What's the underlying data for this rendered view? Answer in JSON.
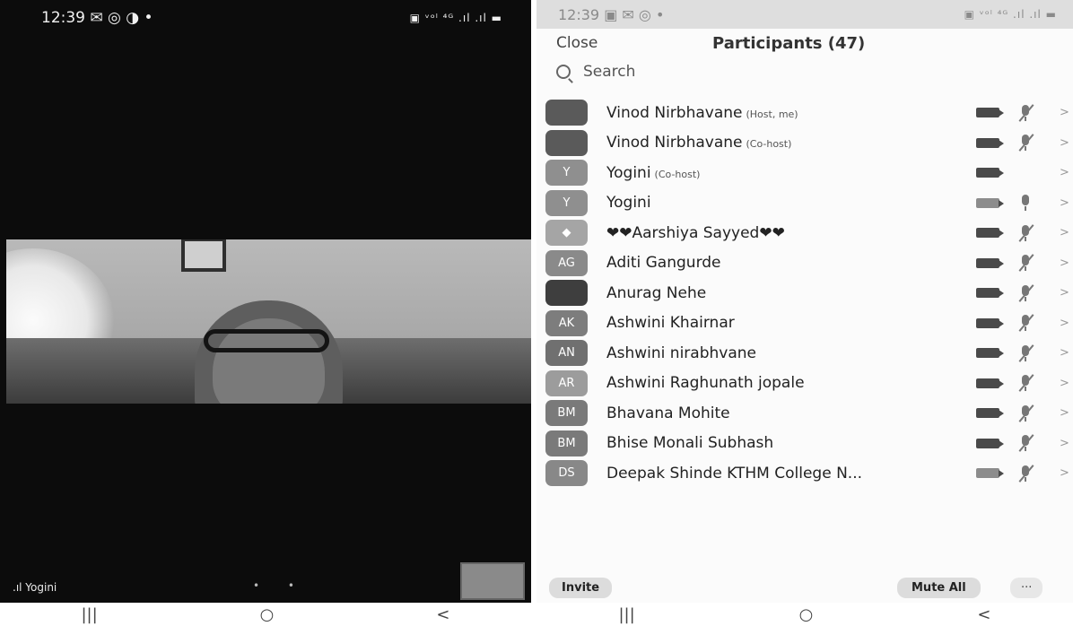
{
  "left_screen": {
    "status_bar": {
      "time": "12:39",
      "icons": "✉ ◎ ◑ •",
      "right": "▣ ᵛᵒˡ ⁴ᴳ .ıl .ıl ▬"
    },
    "video_label": "Yogini",
    "page_dots": "• •",
    "nav": {
      "recents": "|||",
      "home": "○",
      "back": "<"
    }
  },
  "right_screen": {
    "status_bar": {
      "time": "12:39",
      "icons": "▣ ✉ ◎ •",
      "right": "▣ ᵛᵒˡ ⁴ᴳ .ıl .ıl ▬"
    },
    "header": {
      "close": "Close",
      "title": "Participants (47)"
    },
    "search_placeholder": "Search",
    "participants": [
      {
        "initials": "",
        "avatar_color": "#5a5a5a",
        "name": "Vinod Nirbhavane",
        "role": "(Host, me)",
        "cam": "off",
        "mic": "muted"
      },
      {
        "initials": "",
        "avatar_color": "#5a5a5a",
        "name": "Vinod Nirbhavane",
        "role": "(Co-host)",
        "cam": "off",
        "mic": "muted"
      },
      {
        "initials": "Y",
        "avatar_color": "#8f8f8f",
        "name": "Yogini",
        "role": "(Co-host)",
        "cam": "off",
        "mic": "none"
      },
      {
        "initials": "Y",
        "avatar_color": "#8f8f8f",
        "name": "Yogini",
        "role": "",
        "cam": "on",
        "mic": "on"
      },
      {
        "initials": "◆",
        "avatar_color": "#a5a5a5",
        "name": "❤❤Aarshiya Sayyed❤❤",
        "role": "",
        "cam": "off",
        "mic": "muted"
      },
      {
        "initials": "AG",
        "avatar_color": "#8a8a8a",
        "name": "Aditi Gangurde",
        "role": "",
        "cam": "off",
        "mic": "muted"
      },
      {
        "initials": "",
        "avatar_color": "#3e3e3e",
        "name": "Anurag Nehe",
        "role": "",
        "cam": "off",
        "mic": "muted"
      },
      {
        "initials": "AK",
        "avatar_color": "#7d7d7d",
        "name": "Ashwini Khairnar",
        "role": "",
        "cam": "off",
        "mic": "muted"
      },
      {
        "initials": "AN",
        "avatar_color": "#707070",
        "name": "Ashwini nirabhvane",
        "role": "",
        "cam": "off",
        "mic": "muted"
      },
      {
        "initials": "AR",
        "avatar_color": "#9c9c9c",
        "name": "Ashwini Raghunath jopale",
        "role": "",
        "cam": "off",
        "mic": "muted"
      },
      {
        "initials": "BM",
        "avatar_color": "#7a7a7a",
        "name": "Bhavana Mohite",
        "role": "",
        "cam": "off",
        "mic": "muted"
      },
      {
        "initials": "BM",
        "avatar_color": "#7a7a7a",
        "name": "Bhise Monali Subhash",
        "role": "",
        "cam": "off",
        "mic": "muted"
      },
      {
        "initials": "DS",
        "avatar_color": "#888888",
        "name": "Deepak Shinde KTHM College N...",
        "role": "",
        "cam": "on",
        "mic": "muted"
      }
    ],
    "footer": {
      "invite": "Invite",
      "mute_all": "Mute All",
      "more": "···"
    },
    "nav": {
      "recents": "|||",
      "home": "○",
      "back": "<"
    }
  }
}
